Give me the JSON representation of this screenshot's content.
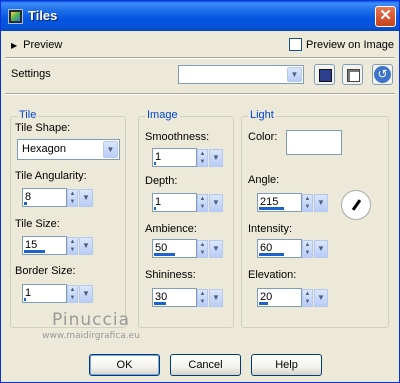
{
  "window": {
    "title": "Tiles"
  },
  "top": {
    "preview_label": "Preview",
    "preview_on_image_label": "Preview on Image",
    "settings_label": "Settings",
    "settings_value": ""
  },
  "tile": {
    "group_title": "Tile",
    "shape_label": "Tile Shape:",
    "shape_value": "Hexagon",
    "angularity_label": "Tile Angularity:",
    "angularity_value": "8",
    "angularity_level": 0.08,
    "size_label": "Tile Size:",
    "size_value": "15",
    "size_level": 0.5,
    "border_label": "Border Size:",
    "border_value": "1",
    "border_level": 0.05
  },
  "image": {
    "group_title": "Image",
    "smoothness_label": "Smoothness:",
    "smoothness_value": "1",
    "smoothness_level": 0.02,
    "depth_label": "Depth:",
    "depth_value": "1",
    "depth_level": 0.02,
    "ambience_label": "Ambience:",
    "ambience_value": "50",
    "ambience_level": 0.5,
    "shininess_label": "Shininess:",
    "shininess_value": "30",
    "shininess_level": 0.3
  },
  "light": {
    "group_title": "Light",
    "color_label": "Color:",
    "color": "#ffffff",
    "angle_label": "Angle:",
    "angle_value": "215",
    "angle_level": 0.6,
    "intensity_label": "Intensity:",
    "intensity_value": "60",
    "intensity_level": 0.6,
    "elevation_label": "Elevation:",
    "elevation_value": "20",
    "elevation_level": 0.22
  },
  "watermark": {
    "name": "Pinuccia",
    "site": "www.maidirgrafica.eu"
  },
  "buttons": {
    "ok": "OK",
    "cancel": "Cancel",
    "help": "Help"
  },
  "icons": {
    "app": "app-icon",
    "close": "close-icon",
    "save": "save-icon",
    "random": "dice-icon",
    "reset": "reset-icon",
    "dial": "angle-dial-icon"
  },
  "colors": {
    "titlebar": "#0554df",
    "group_title": "#0046d5",
    "accent_bar": "#1c63d0"
  }
}
